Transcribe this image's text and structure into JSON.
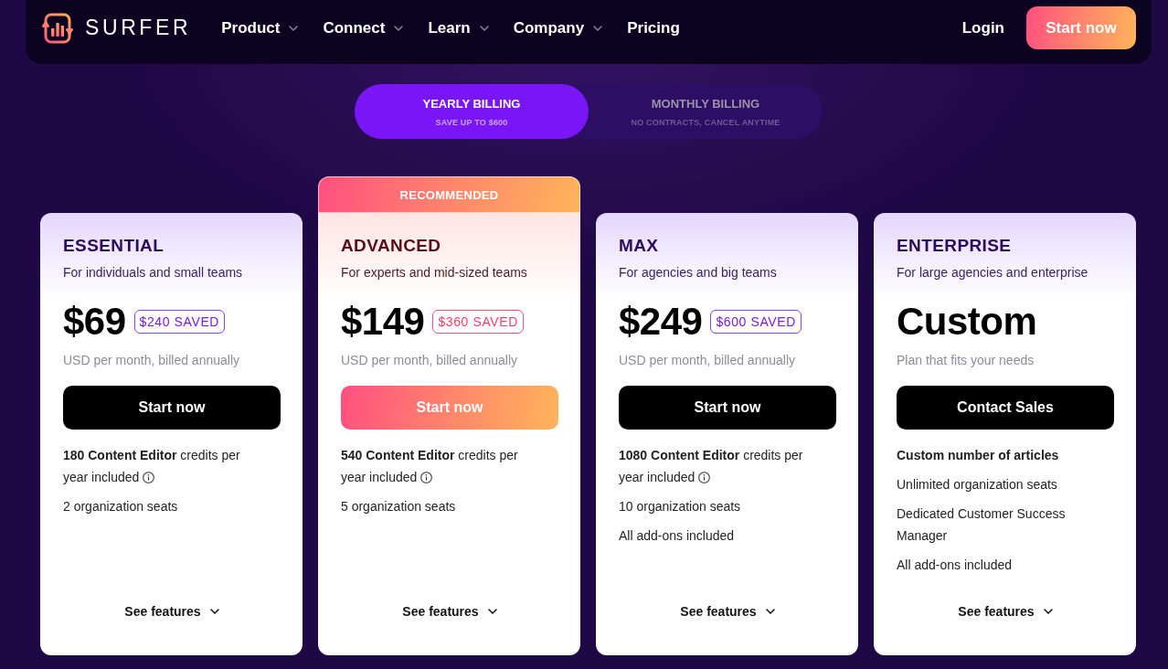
{
  "nav": {
    "logo_text": "SURFER",
    "items": [
      {
        "label": "Product",
        "dropdown": true
      },
      {
        "label": "Connect",
        "dropdown": true
      },
      {
        "label": "Learn",
        "dropdown": true
      },
      {
        "label": "Company",
        "dropdown": true
      },
      {
        "label": "Pricing",
        "dropdown": false
      }
    ],
    "login": "Login",
    "cta": "Start now"
  },
  "billing_toggle": [
    {
      "label": "YEARLY BILLING",
      "sublabel": "SAVE UP TO $600",
      "selected": true
    },
    {
      "label": "MONTHLY BILLING",
      "sublabel": "NO CONTRACTS, CANCEL ANYTIME",
      "selected": false
    }
  ],
  "plans": [
    {
      "name": "ESSENTIAL",
      "tagline": "For individuals and small teams",
      "recommended": false,
      "price": "$69",
      "saved": "$240 SAVED",
      "price_note": "USD per month, billed annually",
      "button": "Start now",
      "features": [
        {
          "text": "**180 Content Editor** credits per year included",
          "bold": false,
          "info": true
        },
        {
          "text": "2 organization seats",
          "bold": false,
          "info": false
        }
      ],
      "see_features": "See features"
    },
    {
      "name": "ADVANCED",
      "tagline": "For experts and mid-sized teams",
      "recommended": true,
      "ribbon": "RECOMMENDED",
      "price": "$149",
      "saved": "$360 SAVED",
      "price_note": "USD per month, billed annually",
      "button": "Start now",
      "features": [
        {
          "text": "**540 Content Editor** credits per year included",
          "bold": false,
          "info": true
        },
        {
          "text": "5 organization seats",
          "bold": false,
          "info": false
        }
      ],
      "see_features": "See features"
    },
    {
      "name": "MAX",
      "tagline": "For agencies and big teams",
      "recommended": false,
      "price": "$249",
      "saved": "$600 SAVED",
      "price_note": "USD per month, billed annually",
      "button": "Start now",
      "features": [
        {
          "text": "**1080 Content Editor** credits per year included",
          "bold": false,
          "info": true
        },
        {
          "text": "10 organization seats",
          "bold": false,
          "info": false
        },
        {
          "text": "All add-ons included",
          "bold": false,
          "info": false
        }
      ],
      "see_features": "See features"
    },
    {
      "name": "ENTERPRISE",
      "tagline": "For large agencies and enterprise",
      "recommended": false,
      "price": "Custom",
      "price_note": "Plan that fits your needs",
      "button": "Contact Sales",
      "features": [
        {
          "text": "Custom number of articles",
          "bold": true,
          "info": false
        },
        {
          "text": "Unlimited organization seats",
          "bold": false,
          "info": false
        },
        {
          "text": "Dedicated Customer Success Manager",
          "bold": false,
          "info": false
        },
        {
          "text": "All add-ons included",
          "bold": false,
          "info": false
        }
      ],
      "see_features": "See features"
    }
  ]
}
